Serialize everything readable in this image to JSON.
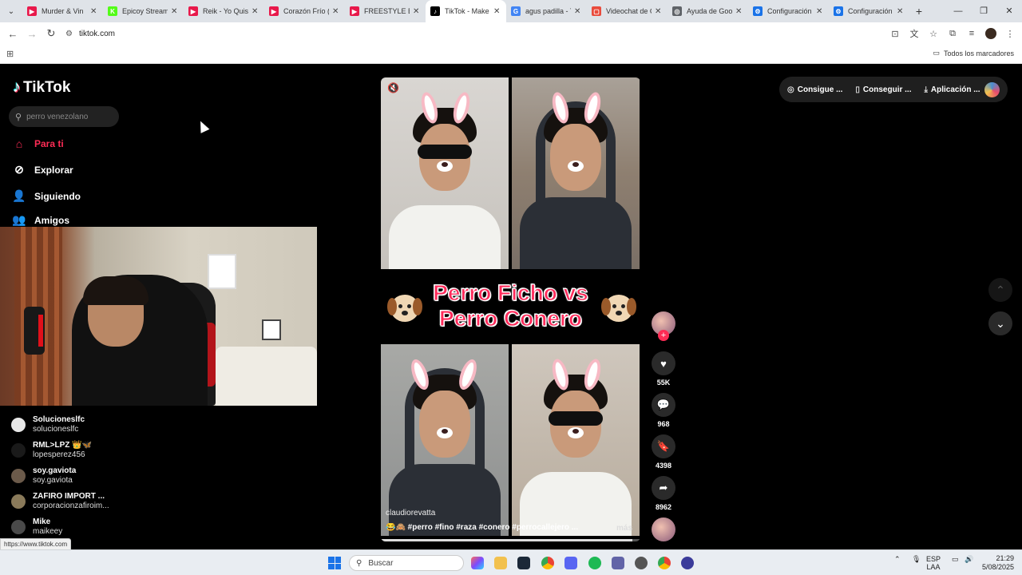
{
  "browser": {
    "tabs": [
      {
        "title": "Murder & Vin",
        "fav_color": "#e8194b",
        "fav_glyph": "▶"
      },
      {
        "title": "Epicoy Stream",
        "fav_color": "#53fc18",
        "fav_glyph": "K"
      },
      {
        "title": "Reik - Yo Quisie",
        "fav_color": "#e8194b",
        "fav_glyph": "▶"
      },
      {
        "title": "Corazón Frío (L",
        "fav_color": "#e8194b",
        "fav_glyph": "▶"
      },
      {
        "title": "FREESTYLE ÉPI",
        "fav_color": "#e8194b",
        "fav_glyph": "▶"
      },
      {
        "title": "TikTok - Make",
        "fav_color": "#000000",
        "fav_glyph": "♪",
        "active": true
      },
      {
        "title": "agus padilla - T",
        "fav_color": "#4285f4",
        "fav_glyph": "G"
      },
      {
        "title": "Videochat de C",
        "fav_color": "#e94b3c",
        "fav_glyph": "▢"
      },
      {
        "title": "Ayuda de Goo",
        "fav_color": "#5f6368",
        "fav_glyph": "◎"
      },
      {
        "title": "Configuración",
        "fav_color": "#1a73e8",
        "fav_glyph": "⚙"
      },
      {
        "title": "Configuración",
        "fav_color": "#1a73e8",
        "fav_glyph": "⚙"
      }
    ],
    "url": "tiktok.com",
    "bookmarks_all": "Todos los marcadores",
    "status_url": "https://www.tiktok.com"
  },
  "tiktok": {
    "logo": "TikTok",
    "search_placeholder": "perro venezolano",
    "nav": [
      {
        "label": "Para ti",
        "icon": "home-icon",
        "active": true
      },
      {
        "label": "Explorar",
        "icon": "compass-icon"
      },
      {
        "label": "Siguiendo",
        "icon": "following-icon"
      },
      {
        "label": "Amigos",
        "icon": "friends-icon"
      }
    ],
    "accounts": [
      {
        "name": "Solucioneslfc",
        "handle": "solucioneslfc",
        "avatar_color": "#e8e8e8"
      },
      {
        "name": "RML>LPZ 👑🦋",
        "handle": "lopesperez456",
        "avatar_color": "#1a1a1a"
      },
      {
        "name": "soy.gaviota",
        "handle": "soy.gaviota",
        "avatar_color": "#6b5a4a"
      },
      {
        "name": "ZAFIRO IMPORT ...",
        "handle": "corporacionzafiroim...",
        "avatar_color": "#8a7a5a"
      },
      {
        "name": "Mike",
        "handle": "maikeey",
        "avatar_color": "#4a4a4a"
      }
    ],
    "top_right": {
      "coins": "Consigue ...",
      "get_app_mobile": "Conseguir ...",
      "app": "Aplicación ..."
    },
    "video": {
      "title_line1": "Perro Ficho vs",
      "title_line2": "Perro Conero",
      "author": "claudiorevatta",
      "caption": "😂🙈 #perro #fino #raza #conero #perrocallejero ...",
      "more": "más",
      "progress": 0.97
    },
    "actions": {
      "likes": "55K",
      "comments": "968",
      "saves": "4398",
      "shares": "8962"
    }
  },
  "taskbar": {
    "search_placeholder": "Buscar",
    "lang_line1": "ESP",
    "lang_line2": "LAA",
    "time": "21:29",
    "date": "5/08/2025"
  }
}
